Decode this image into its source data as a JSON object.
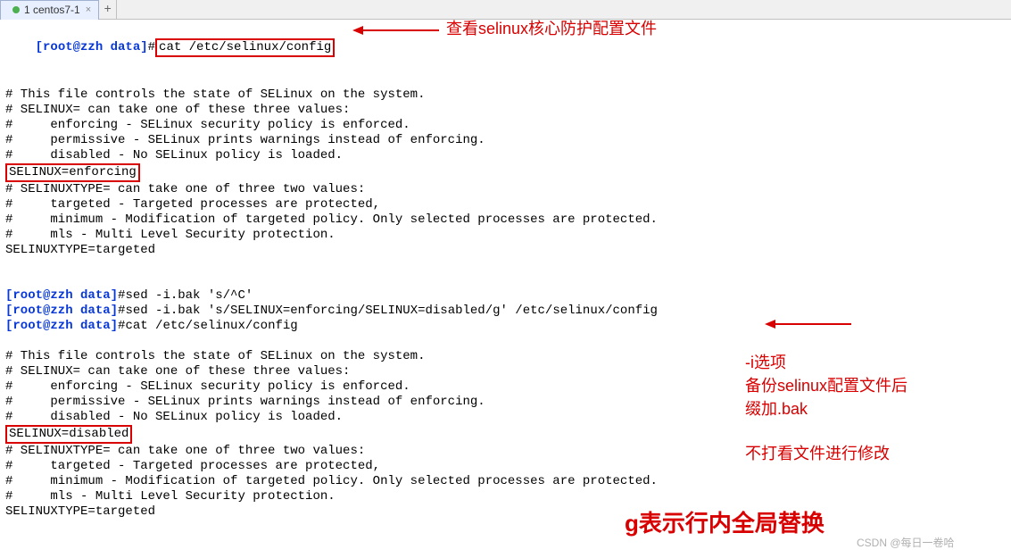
{
  "tab": {
    "title": "1 centos7-1",
    "close": "×",
    "add": "+"
  },
  "block1": {
    "prompt": "[root@zzh data]",
    "hash": "#",
    "cmd": "cat /etc/selinux/config",
    "annot": "查看selinux核心防护配置文件",
    "out": [
      "",
      "# This file controls the state of SELinux on the system.",
      "# SELINUX= can take one of these three values:",
      "#     enforcing - SELinux security policy is enforced.",
      "#     permissive - SELinux prints warnings instead of enforcing.",
      "#     disabled - No SELinux policy is loaded."
    ],
    "highlight": "SELINUX=enforcing",
    "out2": [
      "# SELINUXTYPE= can take one of three two values:",
      "#     targeted - Targeted processes are protected,",
      "#     minimum - Modification of targeted policy. Only selected processes are protected.",
      "#     mls - Multi Level Security protection.",
      "SELINUXTYPE=targeted",
      "",
      ""
    ]
  },
  "block2": {
    "lines": [
      {
        "prompt": "[root@zzh data]",
        "hash": "#",
        "cmd": "sed -i.bak 's/^C'"
      },
      {
        "prompt": "[root@zzh data]",
        "hash": "#",
        "cmd": "sed -i.bak 's/SELINUX=enforcing/SELINUX=disabled/g' /etc/selinux/config"
      },
      {
        "prompt": "[root@zzh data]",
        "hash": "#",
        "cmd": "cat /etc/selinux/config"
      }
    ],
    "out": [
      "",
      "# This file controls the state of SELinux on the system.",
      "# SELINUX= can take one of these three values:",
      "#     enforcing - SELinux security policy is enforced.",
      "#     permissive - SELinux prints warnings instead of enforcing.",
      "#     disabled - No SELinux policy is loaded."
    ],
    "highlight": "SELINUX=disabled",
    "out2": [
      "# SELINUXTYPE= can take one of three two values:",
      "#     targeted - Targeted processes are protected,",
      "#     minimum - Modification of targeted policy. Only selected processes are protected.",
      "#     mls - Multi Level Security protection.",
      "SELINUXTYPE=targeted"
    ]
  },
  "side": {
    "a1": "-i选项",
    "a2": "备份selinux配置文件后",
    "a3": "缀加.bak",
    "a4": "不打看文件进行修改"
  },
  "big": "g表示行内全局替换",
  "watermark": "CSDN @每日一卷哈"
}
